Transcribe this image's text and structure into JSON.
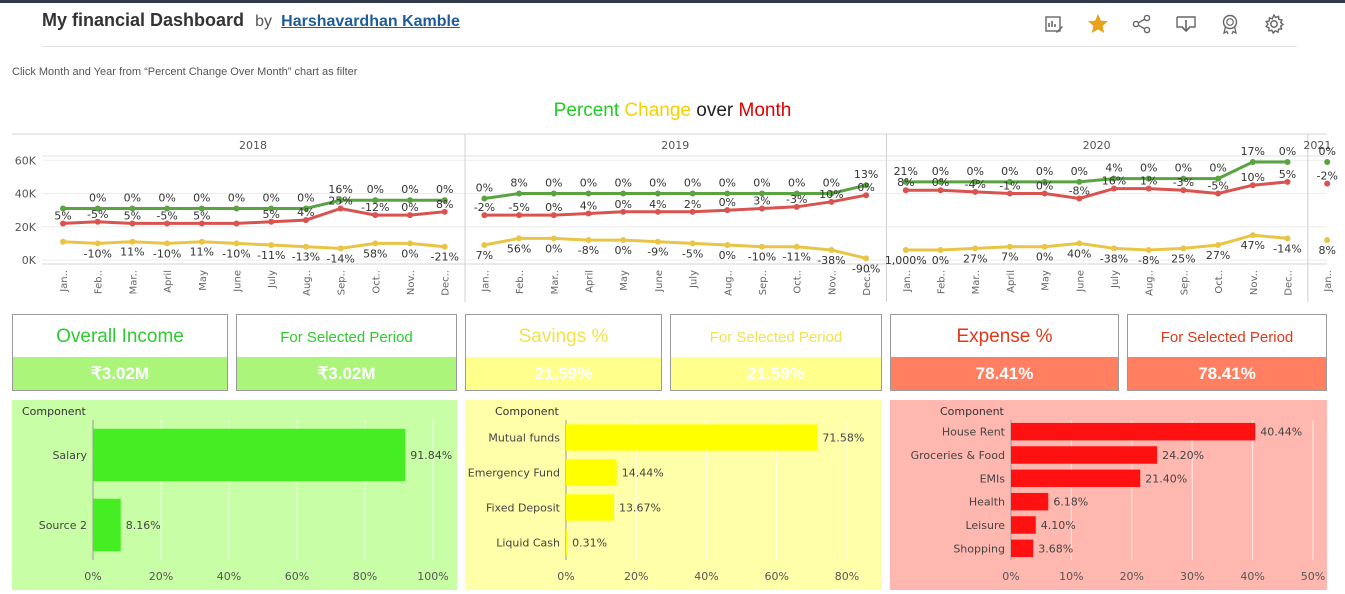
{
  "header": {
    "title": "My financial Dashboard",
    "by": "by",
    "author": "Harshavardhan Kamble"
  },
  "toolbar": {
    "icons": [
      "data-guide-icon",
      "favorite-star-icon",
      "share-icon",
      "download-icon",
      "badge-icon",
      "settings-icon"
    ],
    "star_color": "#e8a21c"
  },
  "hint": "Click Month and Year from “Percent Change Over Month” chart as filter",
  "chart_title": {
    "w1": "Percent",
    "w2": "Change",
    "w3": "over",
    "w4": "Month",
    "c1": "#22cc22",
    "c2": "#f7d000",
    "c3": "#222222",
    "c4": "#e00000"
  },
  "chart_data": [
    {
      "type": "line",
      "title": "Percent Change over Month",
      "years": [
        "2018",
        "2019",
        "2020",
        "2021"
      ],
      "months": [
        "Jan..",
        "Feb..",
        "Mar..",
        "April",
        "May",
        "June",
        "July",
        "Aug..",
        "Sep..",
        "Oct..",
        "Nov..",
        "Dec.."
      ],
      "y_ticks": [
        "60K",
        "40K",
        "20K",
        "0K"
      ],
      "ylim": [
        0,
        65000
      ],
      "grid": true,
      "series": [
        {
          "color": "#5aa342",
          "values": [
            31000,
            31000,
            31000,
            31000,
            31000,
            31000,
            31000,
            31000,
            36000,
            36000,
            36000,
            36000,
            37000,
            40000,
            40000,
            40000,
            40000,
            40000,
            40000,
            40000,
            40000,
            40000,
            40000,
            45000,
            47000,
            47000,
            47000,
            47000,
            47000,
            47000,
            49000,
            49000,
            49000,
            49000,
            59000,
            59000,
            59000
          ],
          "labels": [
            "",
            "0%",
            "0%",
            "0%",
            "0%",
            "0%",
            "0%",
            "0%",
            "16%",
            "0%",
            "0%",
            "0%",
            "0%",
            "8%",
            "0%",
            "0%",
            "0%",
            "0%",
            "0%",
            "0%",
            "0%",
            "0%",
            "0%",
            "13%",
            "21%",
            "0%",
            "0%",
            "0%",
            "0%",
            "0%",
            "4%",
            "0%",
            "0%",
            "0%",
            "17%",
            "0%",
            "0%"
          ]
        },
        {
          "color": "#d9534f",
          "values": [
            22000,
            23000,
            22000,
            22000,
            22000,
            22000,
            23000,
            24000,
            31000,
            27000,
            27000,
            29000,
            27000,
            27000,
            27000,
            28000,
            29000,
            29000,
            29000,
            30000,
            31000,
            32000,
            35000,
            39000,
            42000,
            42000,
            41000,
            40000,
            40000,
            37000,
            43000,
            43000,
            42000,
            40000,
            45000,
            47000,
            46000
          ],
          "labels": [
            "5%",
            "-5%",
            "5%",
            "-5%",
            "5%",
            "",
            "5%",
            "4%",
            "25%",
            "-12%",
            "0%",
            "8%",
            "-2%",
            "-5%",
            "0%",
            "4%",
            "0%",
            "4%",
            "2%",
            "0%",
            "3%",
            "-3%",
            "10%",
            "0%",
            "8%",
            "0%",
            "-4%",
            "-1%",
            "0%",
            "-8%",
            "16%",
            "1%",
            "-3%",
            "-5%",
            "10%",
            "5%",
            "-2%"
          ]
        },
        {
          "color": "#e8c547",
          "values": [
            11000,
            10000,
            11000,
            10000,
            11000,
            10000,
            9000,
            8000,
            7000,
            10000,
            10000,
            8000,
            9000,
            13000,
            13000,
            12000,
            12000,
            11000,
            10000,
            9000,
            8000,
            8000,
            6000,
            1000,
            6000,
            6000,
            7000,
            8000,
            8000,
            10000,
            7000,
            6000,
            7000,
            9000,
            15000,
            13000,
            12000
          ],
          "labels": [
            "",
            "-10%",
            "11%",
            "-10%",
            "11%",
            "-10%",
            "-11%",
            "-13%",
            "-14%",
            "58%",
            "0%",
            "-21%",
            "7%",
            "56%",
            "0%",
            "-8%",
            "0%",
            "-9%",
            "-5%",
            "0%",
            "-10%",
            "-11%",
            "-38%",
            "-90%",
            "1,000%",
            "0%",
            "27%",
            "7%",
            "0%",
            "40%",
            "-38%",
            "-8%",
            "25%",
            "27%",
            "47%",
            "-14%",
            "8%"
          ]
        }
      ]
    },
    {
      "type": "bar",
      "title": "",
      "category_header": "Component",
      "categories": [
        "Salary",
        "Source 2"
      ],
      "values": [
        91.84,
        8.16
      ],
      "value_labels": [
        "91.84%",
        "8.16%"
      ],
      "x_ticks": [
        "0%",
        "20%",
        "40%",
        "60%",
        "80%",
        "100%"
      ],
      "xlim": [
        0,
        100
      ],
      "bar_color": "#44ee22",
      "bg": "#c8ffa6"
    },
    {
      "type": "bar",
      "title": "",
      "category_header": "Component",
      "categories": [
        "Mutual funds",
        "Emergency Fund",
        "Fixed Deposit",
        "Liquid Cash"
      ],
      "values": [
        71.58,
        14.44,
        13.67,
        0.31
      ],
      "value_labels": [
        "71.58%",
        "14.44%",
        "13.67%",
        "0.31%"
      ],
      "x_ticks": [
        "0%",
        "20%",
        "40%",
        "60%",
        "80%"
      ],
      "xlim": [
        0,
        80
      ],
      "bar_color": "#ffff00",
      "bg": "#ffffaa"
    },
    {
      "type": "bar",
      "title": "",
      "category_header": "Component",
      "categories": [
        "House Rent",
        "Groceries & Food",
        "EMIs",
        "Health",
        "Leisure",
        "Shopping"
      ],
      "values": [
        40.44,
        24.2,
        21.4,
        6.18,
        4.1,
        3.68
      ],
      "value_labels": [
        "40.44%",
        "24.20%",
        "21.40%",
        "6.18%",
        "4.10%",
        "3.68%"
      ],
      "x_ticks": [
        "0%",
        "10%",
        "20%",
        "30%",
        "40%",
        "50%"
      ],
      "xlim": [
        0,
        50
      ],
      "bar_color": "#ff1111",
      "bg": "#ffb8b0"
    }
  ],
  "kpis": [
    {
      "label": "Overall Income",
      "value": "₹3.02M",
      "label_color": "#2ecc2e",
      "bar_color": "#aaf57a",
      "label_size": "19px"
    },
    {
      "label": "For Selected Period",
      "value": "₹3.02M",
      "label_color": "#2ecc2e",
      "bar_color": "#aaf57a",
      "label_size": "15px"
    },
    {
      "label": "Savings %",
      "value": "21.59%",
      "label_color": "#f3e24a",
      "bar_color": "#ffff8c",
      "label_size": "19px"
    },
    {
      "label": "For Selected Period",
      "value": "21.59%",
      "label_color": "#f3e24a",
      "bar_color": "#ffff8c",
      "label_size": "15px"
    },
    {
      "label": "Expense %",
      "value": "78.41%",
      "label_color": "#e0391a",
      "bar_color": "#ff7f60",
      "label_size": "19px"
    },
    {
      "label": "For Selected Period",
      "value": "78.41%",
      "label_color": "#e0391a",
      "bar_color": "#ff7f60",
      "label_size": "15px"
    }
  ]
}
